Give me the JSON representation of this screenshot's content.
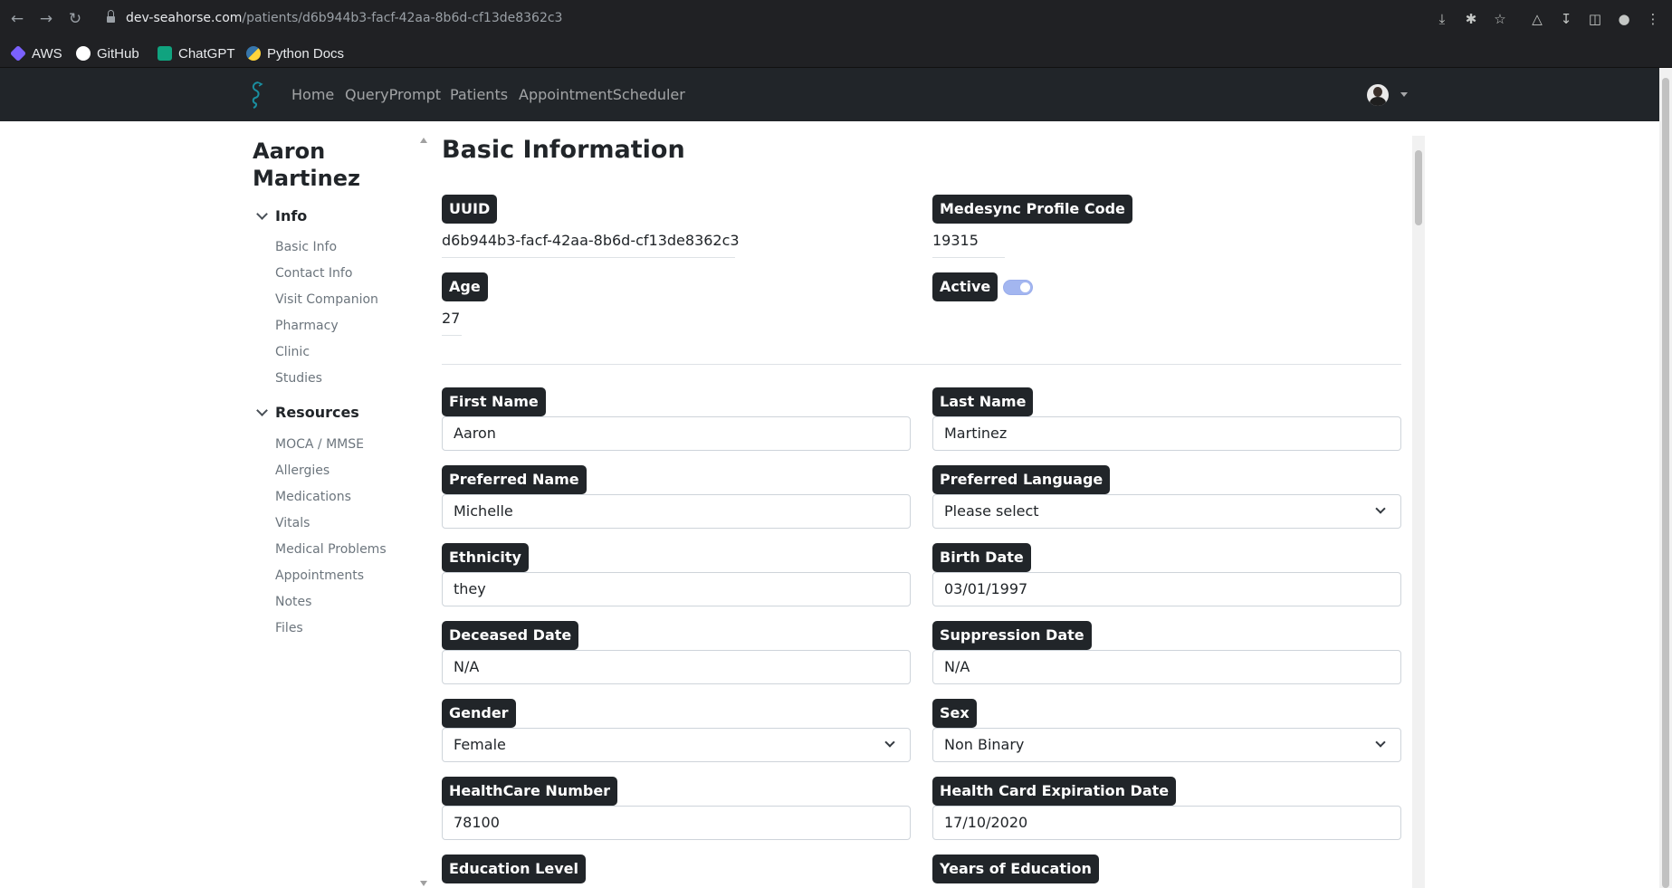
{
  "browser": {
    "url_host": "dev-seahorse.com",
    "url_path": "/patients/d6b944b3-facf-42aa-8b6d-cf13de8362c3",
    "bookmarks": [
      {
        "label": "AWS",
        "icon": "aws-icon",
        "color": "#7b61ff"
      },
      {
        "label": "GitHub",
        "icon": "github-icon",
        "color": "#ffffff"
      },
      {
        "label": "ChatGPT",
        "icon": "chatgpt-icon",
        "color": "#10a37f"
      },
      {
        "label": "Python Docs",
        "icon": "python-icon",
        "color": "#3776ab"
      }
    ]
  },
  "navbar": {
    "links": [
      "Home",
      "QueryPrompt",
      "Patients",
      "AppointmentScheduler"
    ]
  },
  "sidebar": {
    "patient_name": "Aaron Martinez",
    "sections": [
      {
        "title": "Info",
        "items": [
          "Basic Info",
          "Contact Info",
          "Visit Companion",
          "Pharmacy",
          "Clinic",
          "Studies"
        ]
      },
      {
        "title": "Resources",
        "items": [
          "MOCA / MMSE",
          "Allergies",
          "Medications",
          "Vitals",
          "Medical Problems",
          "Appointments",
          "Notes",
          "Files"
        ]
      }
    ]
  },
  "basic_info": {
    "title": "Basic Information",
    "uuid_label": "UUID",
    "uuid_value": "d6b944b3-facf-42aa-8b6d-cf13de8362c3",
    "profile_code_label": "Medesync Profile Code",
    "profile_code_value": "19315",
    "age_label": "Age",
    "age_value": "27",
    "active_label": "Active",
    "active_value": true
  },
  "form": {
    "first_name": {
      "label": "First Name",
      "value": "Aaron"
    },
    "last_name": {
      "label": "Last Name",
      "value": "Martinez"
    },
    "preferred_name": {
      "label": "Preferred Name",
      "value": "Michelle"
    },
    "preferred_language": {
      "label": "Preferred Language",
      "value": "Please select"
    },
    "ethnicity": {
      "label": "Ethnicity",
      "value": "they"
    },
    "birth_date": {
      "label": "Birth Date",
      "value": "03/01/1997"
    },
    "deceased_date": {
      "label": "Deceased Date",
      "value": "N/A"
    },
    "suppression_date": {
      "label": "Suppression Date",
      "value": "N/A"
    },
    "gender": {
      "label": "Gender",
      "value": "Female"
    },
    "sex": {
      "label": "Sex",
      "value": "Non Binary"
    },
    "healthcare_number": {
      "label": "HealthCare Number",
      "value": "78100"
    },
    "health_card_expiration": {
      "label": "Health Card Expiration Date",
      "value": "17/10/2020"
    },
    "education_level": {
      "label": "Education Level",
      "value": ""
    },
    "years_of_education": {
      "label": "Years of Education",
      "value": ""
    }
  },
  "colors": {
    "navbar": "#212529",
    "badge": "#212529",
    "toggle_on": "#a3b6f0"
  }
}
